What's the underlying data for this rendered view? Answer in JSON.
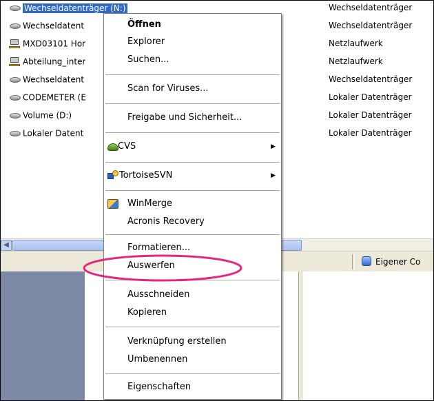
{
  "list": {
    "items": [
      {
        "name": "Wechseldatenträger (N:)",
        "type": "Wechseldatenträger",
        "icon": "removable-drive-icon",
        "selected": true
      },
      {
        "name": "Wechseldatent",
        "type": "Wechseldatenträger",
        "icon": "removable-drive-icon",
        "selected": false
      },
      {
        "name": "MXD03101 Hor",
        "type": "Netzlaufwerk",
        "icon": "network-drive-icon",
        "selected": false
      },
      {
        "name": "Abteilung_inter",
        "type": "Netzlaufwerk",
        "icon": "network-drive-icon",
        "selected": false
      },
      {
        "name": "Wechseldatent",
        "type": "Wechseldatenträger",
        "icon": "removable-drive-icon",
        "selected": false
      },
      {
        "name": "CODEMETER (E",
        "type": "Lokaler Datenträger",
        "icon": "local-disk-icon",
        "selected": false
      },
      {
        "name": "Volume (D:)",
        "type": "Lokaler Datenträger",
        "icon": "local-disk-icon",
        "selected": false
      },
      {
        "name": "Lokaler Datent",
        "type": "Lokaler Datenträger",
        "icon": "local-disk-icon",
        "selected": false
      }
    ]
  },
  "statusbar": {
    "location_label": "Eigener Co",
    "location_icon": "my-computer-icon"
  },
  "menu": {
    "open": "Öffnen",
    "explorer": "Explorer",
    "search": "Suchen...",
    "scan": "Scan for Viruses...",
    "sharing": "Freigabe und Sicherheit...",
    "cvs": "CVS",
    "cvs_icon": "cvs-turtle-icon",
    "tortoise": "TortoiseSVN",
    "tortoise_icon": "tortoisesvn-icon",
    "winmerge": "WinMerge",
    "winmerge_icon": "winmerge-icon",
    "acronis": "Acronis Recovery",
    "format": "Formatieren...",
    "eject": "Auswerfen",
    "cut": "Ausschneiden",
    "copy": "Kopieren",
    "shortcut": "Verknüpfung erstellen",
    "rename": "Umbenennen",
    "properties": "Eigenschaften",
    "submenu_arrow": "▶"
  },
  "annotation": {
    "highlight_color": "#e6267f"
  },
  "colors": {
    "selection": "#316ac5",
    "xp_face": "#ece9d8"
  }
}
